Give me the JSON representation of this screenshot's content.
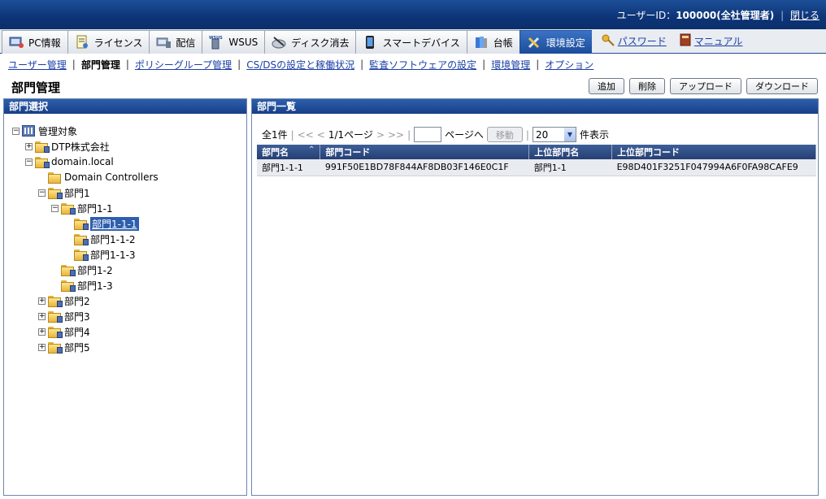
{
  "header": {
    "user_label": "ユーザーID：",
    "user_id": "100000",
    "user_role": "(全社管理者)",
    "logout": "閉じる"
  },
  "tabs": [
    {
      "label": "PC情報",
      "icon": "pc-info-icon"
    },
    {
      "label": "ライセンス",
      "icon": "license-icon"
    },
    {
      "label": "配信",
      "icon": "distribution-icon"
    },
    {
      "label": "WSUS",
      "icon": "wsus-icon"
    },
    {
      "label": "ディスク消去",
      "icon": "disk-erase-icon"
    },
    {
      "label": "スマートデバイス",
      "icon": "smart-device-icon"
    },
    {
      "label": "台帳",
      "icon": "ledger-icon"
    },
    {
      "label": "環境設定",
      "icon": "tools-icon"
    }
  ],
  "tab_links": {
    "password": "パスワード",
    "manual": "マニュアル"
  },
  "subnav": [
    "ユーザー管理",
    "部門管理",
    "ポリシーグループ管理",
    "CS/DSの設定と稼働状況",
    "監査ソフトウェアの設定",
    "環境管理",
    "オプション"
  ],
  "page_title": "部門管理",
  "buttons": {
    "add": "追加",
    "delete": "削除",
    "upload": "アップロード",
    "download": "ダウンロード"
  },
  "left_panel": {
    "title": "部門選択",
    "tree": [
      {
        "label": "管理対象",
        "toggle": "−"
      },
      {
        "label": "DTP株式会社",
        "toggle": "+"
      },
      {
        "label": "domain.local",
        "toggle": "−"
      },
      {
        "label": "Domain Controllers",
        "toggle": ""
      },
      {
        "label": "部門1",
        "toggle": "−"
      },
      {
        "label": "部門1-1",
        "toggle": "−"
      },
      {
        "label": "部門1-1-1",
        "toggle": ""
      },
      {
        "label": "部門1-1-2",
        "toggle": ""
      },
      {
        "label": "部門1-1-3",
        "toggle": ""
      },
      {
        "label": "部門1-2",
        "toggle": ""
      },
      {
        "label": "部門1-3",
        "toggle": ""
      },
      {
        "label": "部門2",
        "toggle": "+"
      },
      {
        "label": "部門3",
        "toggle": "+"
      },
      {
        "label": "部門4",
        "toggle": "+"
      },
      {
        "label": "部門5",
        "toggle": "+"
      }
    ]
  },
  "right_panel": {
    "title": "部門一覧",
    "pager": {
      "total": "全1件",
      "first": "<<",
      "prev": "<",
      "page_info": "1/1ページ",
      "next": ">",
      "last": ">>",
      "page_input": "",
      "goto_label": "ページへ",
      "move_button": "移動",
      "per_page": "20",
      "per_page_suffix": "件表示"
    },
    "columns": [
      "部門名",
      "部門コード",
      "上位部門名",
      "上位部門コード"
    ],
    "rows": [
      [
        "部門1-1-1",
        "991F50E1BD78F844AF8DB03F146E0C1F",
        "部門1-1",
        "E98D401F3251F047994A6F0FA98CAFE9"
      ]
    ]
  }
}
